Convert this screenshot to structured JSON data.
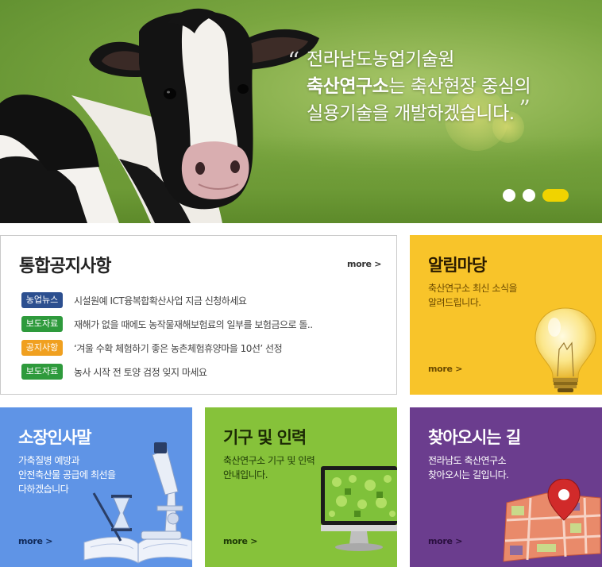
{
  "hero": {
    "quote_open": "“",
    "quote_close": "”",
    "line1": "전라남도농업기술원",
    "line2_bold": "축산연구소",
    "line2_rest": "는 축산현장 중심의",
    "line3": "실용기술을 개발하겠습니다.",
    "slides": 3,
    "active_slide": 3,
    "accent_color": "#f0d300"
  },
  "notice": {
    "title": "통합공지사항",
    "more": "more >",
    "items": [
      {
        "tag": "농업뉴스",
        "tag_color": "blue",
        "text": "시설원예 ICT융복합확산사업 지금 신청하세요"
      },
      {
        "tag": "보도자료",
        "tag_color": "green",
        "text": "재해가 없을 때에도 농작물재해보험료의 일부를 보험금으로 돌.."
      },
      {
        "tag": "공지사항",
        "tag_color": "orange",
        "text": "‘겨울 수확 체험하기 좋은 농촌체험휴양마을 10선’ 선정"
      },
      {
        "tag": "보도자료",
        "tag_color": "green",
        "text": "농사 시작 전 토양 검정 잊지 마세요"
      }
    ]
  },
  "tiles": {
    "alim": {
      "title": "알림마당",
      "desc1": "축산연구소 최신 소식을",
      "desc2": "알려드립니다.",
      "more": "more >",
      "icon": "lightbulb-icon",
      "color": "#f8c42a"
    },
    "sojang": {
      "title": "소장인사말",
      "desc1": "가축질병 예방과",
      "desc2": "안전축산물 공급에 최선을",
      "desc3": "다하겠습니다",
      "more": "more >",
      "icon": "microscope-icon",
      "color": "#5f94e6"
    },
    "gigu": {
      "title": "기구 및 인력",
      "desc1": "축산연구소 기구 및 인력",
      "desc2": "안내입니다.",
      "more": "more >",
      "icon": "monitor-icon",
      "color": "#86c23a"
    },
    "way": {
      "title": "찾아오시는 길",
      "desc1": "전라남도 축산연구소",
      "desc2": "찾아오시는 길입니다.",
      "more": "more >",
      "icon": "map-pin-icon",
      "color": "#6b3d8e"
    }
  }
}
